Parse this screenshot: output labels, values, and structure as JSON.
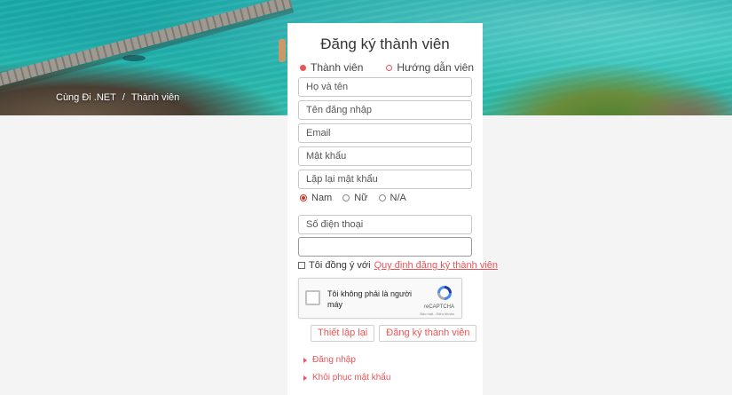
{
  "breadcrumb": {
    "home": "Cùng Đi .NET",
    "separator": "/",
    "current": "Thành viên"
  },
  "form": {
    "title": "Đăng ký thành viên",
    "mode_options": [
      {
        "label": "Thành viên",
        "selected": true
      },
      {
        "label": "Hướng dẫn viên",
        "selected": false
      }
    ],
    "fields": {
      "fullname_placeholder": "Họ và tên",
      "username_placeholder": "Tên đăng nhập",
      "email_placeholder": "Email",
      "password_placeholder": "Mật khẩu",
      "confirm_password_placeholder": "Lặp lại mật khẩu",
      "phone_placeholder": "Số điện thoại",
      "extra_value": ""
    },
    "gender_options": [
      {
        "label": "Nam",
        "selected": true
      },
      {
        "label": "Nữ",
        "selected": false
      },
      {
        "label": "N/A",
        "selected": false
      }
    ],
    "agree": {
      "checked": false,
      "text": "Tôi đồng ý với",
      "link_text": "Quy định đăng ký thành viên"
    },
    "captcha": {
      "text": "Tôi không phải là người máy",
      "brand": "reCAPTCHA",
      "terms": "Bảo mật - Điều khoản"
    },
    "buttons": {
      "reset_label": "Thiết lập lại",
      "submit_label": "Đăng ký thành viên"
    },
    "links": {
      "login_label": "Đăng nhập",
      "recover_label": "Khôi phục mật khẩu"
    }
  },
  "colors": {
    "accent": "#e8565a",
    "background": "#f4f4f4",
    "card": "#ffffff"
  }
}
